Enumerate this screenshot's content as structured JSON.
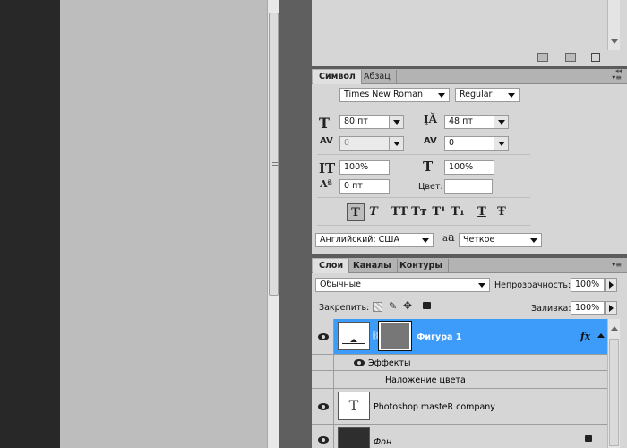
{
  "character_panel": {
    "tabs": [
      "Символ",
      "Абзац"
    ],
    "font_family": "Times New Roman",
    "font_style": "Regular",
    "font_size": "80 пт",
    "leading": "48 пт",
    "kerning": "0",
    "tracking": "0",
    "vertical_scale": "100%",
    "horizontal_scale": "100%",
    "baseline_shift": "0 пт",
    "color_label": "Цвет:",
    "language": "Английский: США",
    "antialias_icon_text": "a",
    "antialias_icon_text2": "a",
    "antialias": "Четкое",
    "style_buttons": [
      "T",
      "T",
      "TT",
      "Tт",
      "T¹",
      "T₁",
      "T",
      "Ŧ"
    ]
  },
  "layers_panel": {
    "tabs": [
      "Слои",
      "Каналы",
      "Контуры"
    ],
    "blend_mode": "Обычные",
    "opacity_label": "Непрозрачность:",
    "opacity": "100%",
    "lock_label": "Закрепить:",
    "fill_label": "Заливка:",
    "fill": "100%",
    "layers": [
      {
        "name": "Фигура 1",
        "selected": true,
        "fx": "fx"
      },
      {
        "name": "Эффекты"
      },
      {
        "name": "Наложение цвета"
      },
      {
        "name": "Photoshop masteR company",
        "thumb": "T"
      },
      {
        "name": "Фон"
      }
    ]
  },
  "colors": {
    "selection": "#3d9bfa",
    "panel_bg": "#d6d6d6",
    "canvas": "#bdbdbd",
    "dark": "#282828"
  }
}
